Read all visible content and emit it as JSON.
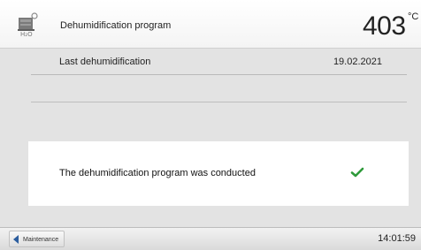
{
  "header": {
    "icon": "dehumidification-program-icon",
    "title": "Dehumidification program",
    "temperature": "403",
    "temperature_unit": "°C"
  },
  "last_dehumidification": {
    "label": "Last dehumidification",
    "value": "19.02.2021"
  },
  "message": {
    "text": "The dehumidification program was conducted",
    "status_icon": "checkmark-icon",
    "status_color": "#2e9a3a"
  },
  "footer": {
    "back_label": "Maintenance",
    "back_icon": "back-arrow-icon",
    "time": "14:01:59"
  }
}
